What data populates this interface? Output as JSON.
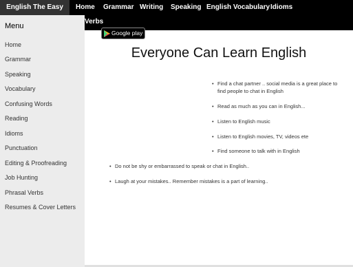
{
  "topnav": {
    "brand": "English The Easy Way",
    "links": [
      "Home",
      "Grammar",
      "Writing",
      "Speaking",
      "English Vocabulary",
      "Idioms",
      "Verbs"
    ]
  },
  "sidebar": {
    "title": "Menu",
    "items": [
      "Home",
      "Grammar",
      "Speaking",
      "Vocabulary",
      "Confusing Words",
      "Reading",
      "Idioms",
      "Punctuation",
      "Editing & Proofreading",
      "Job Hunting",
      "Phrasal Verbs",
      "Resumes & Cover Letters"
    ]
  },
  "badge": {
    "label": "Google play",
    "icon": "play-triangle-icon"
  },
  "main": {
    "title": "Everyone Can Learn English",
    "tips": [
      "Find a chat partner .. social media is a great place to find people to chat in English",
      "Read as much as you can in English...",
      "Listen to English music",
      "Listen to English movies, TV, videos ete",
      "Find someone to talk with in English",
      "Do not be shy or embarrassed to speak or chat in English..",
      "Laugh at your mistakes.. Remember mistakes is a part of learning.."
    ]
  }
}
